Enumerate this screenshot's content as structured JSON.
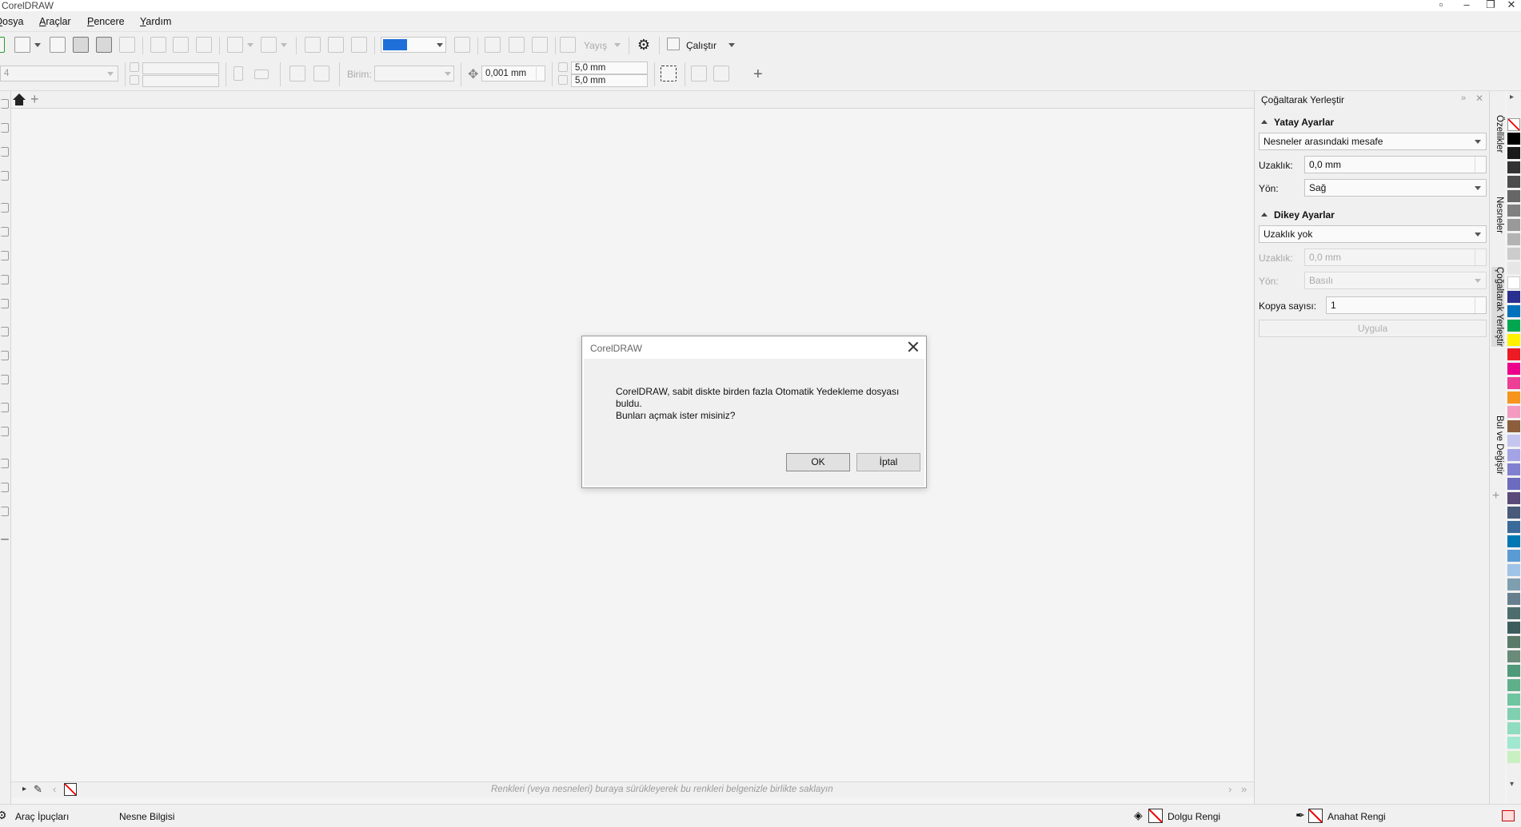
{
  "app": {
    "title": "CorelDRAW"
  },
  "menu": {
    "items": [
      "Dosya",
      "Araçlar",
      "Pencere",
      "Yardım"
    ]
  },
  "toolbar": {
    "publish_label": "Yayış",
    "run_label": "Çalıştır",
    "units_label": "Birim:",
    "nudge_value": "0,001 mm",
    "dup_x": "5,0 mm",
    "dup_y": "5,0 mm",
    "size_field": "4"
  },
  "doc_palette": {
    "hint": "Renkleri (veya nesneleri) buraya sürükleyerek bu renkleri belgenizle birlikte saklayın"
  },
  "status": {
    "tool_hints": "Araç İpuçları",
    "object_info": "Nesne Bilgisi",
    "fill_color": "Dolgu Rengi",
    "outline_color": "Anahat Rengi"
  },
  "docker": {
    "title": "Çoğaltarak Yerleştir",
    "horizontal": {
      "title": "Yatay Ayarlar",
      "mode": "Nesneler arasındaki mesafe",
      "distance_label": "Uzaklık:",
      "distance_value": "0,0 mm",
      "direction_label": "Yön:",
      "direction_value": "Sağ"
    },
    "vertical": {
      "title": "Dikey Ayarlar",
      "mode": "Uzaklık yok",
      "distance_label": "Uzaklık:",
      "distance_value": "0,0 mm",
      "direction_label": "Yön:",
      "direction_value": "Basılı"
    },
    "copies_label": "Kopya sayısı:",
    "copies_value": "1",
    "apply_label": "Uygula"
  },
  "vertical_tabs": [
    "Özellikler",
    "Nesneler",
    "Çoğaltarak Yerleştir",
    "Bul ve Değiştir"
  ],
  "palette_colors": [
    "#000000",
    "#1a1a1a",
    "#333333",
    "#4d4d4d",
    "#666666",
    "#808080",
    "#999999",
    "#b3b3b3",
    "#cccccc",
    "#e6e6e6",
    "#ffffff",
    "#2b2f8f",
    "#0072bc",
    "#00a650",
    "#fff200",
    "#ed1c24",
    "#ec008c",
    "#ee3f96",
    "#f7941d",
    "#f49ac1",
    "#8b5e3c",
    "#c5c5f0",
    "#a3a3e6",
    "#8080d0",
    "#6b6bbf",
    "#5a4a7a",
    "#4a5a7a",
    "#3a6a9a",
    "#0078b4",
    "#5b9bd5",
    "#a0c4e8",
    "#7f9fb0",
    "#667f8f",
    "#4d6d6d",
    "#3d5d5d",
    "#5a7a6a",
    "#6a8a7a",
    "#4f9a7a",
    "#5fb08a",
    "#6fc5a0",
    "#7fd0b0",
    "#90dcc0",
    "#a0e8d0",
    "#c8f0c0"
  ],
  "dialog": {
    "title": "CorelDRAW",
    "message_line1": "CorelDRAW, sabit diskte birden fazla Otomatik Yedekleme dosyası",
    "message_line2": "buldu.",
    "message_line3": "Bunları açmak ister misiniz?",
    "ok_label": "OK",
    "cancel_label": "İptal"
  }
}
